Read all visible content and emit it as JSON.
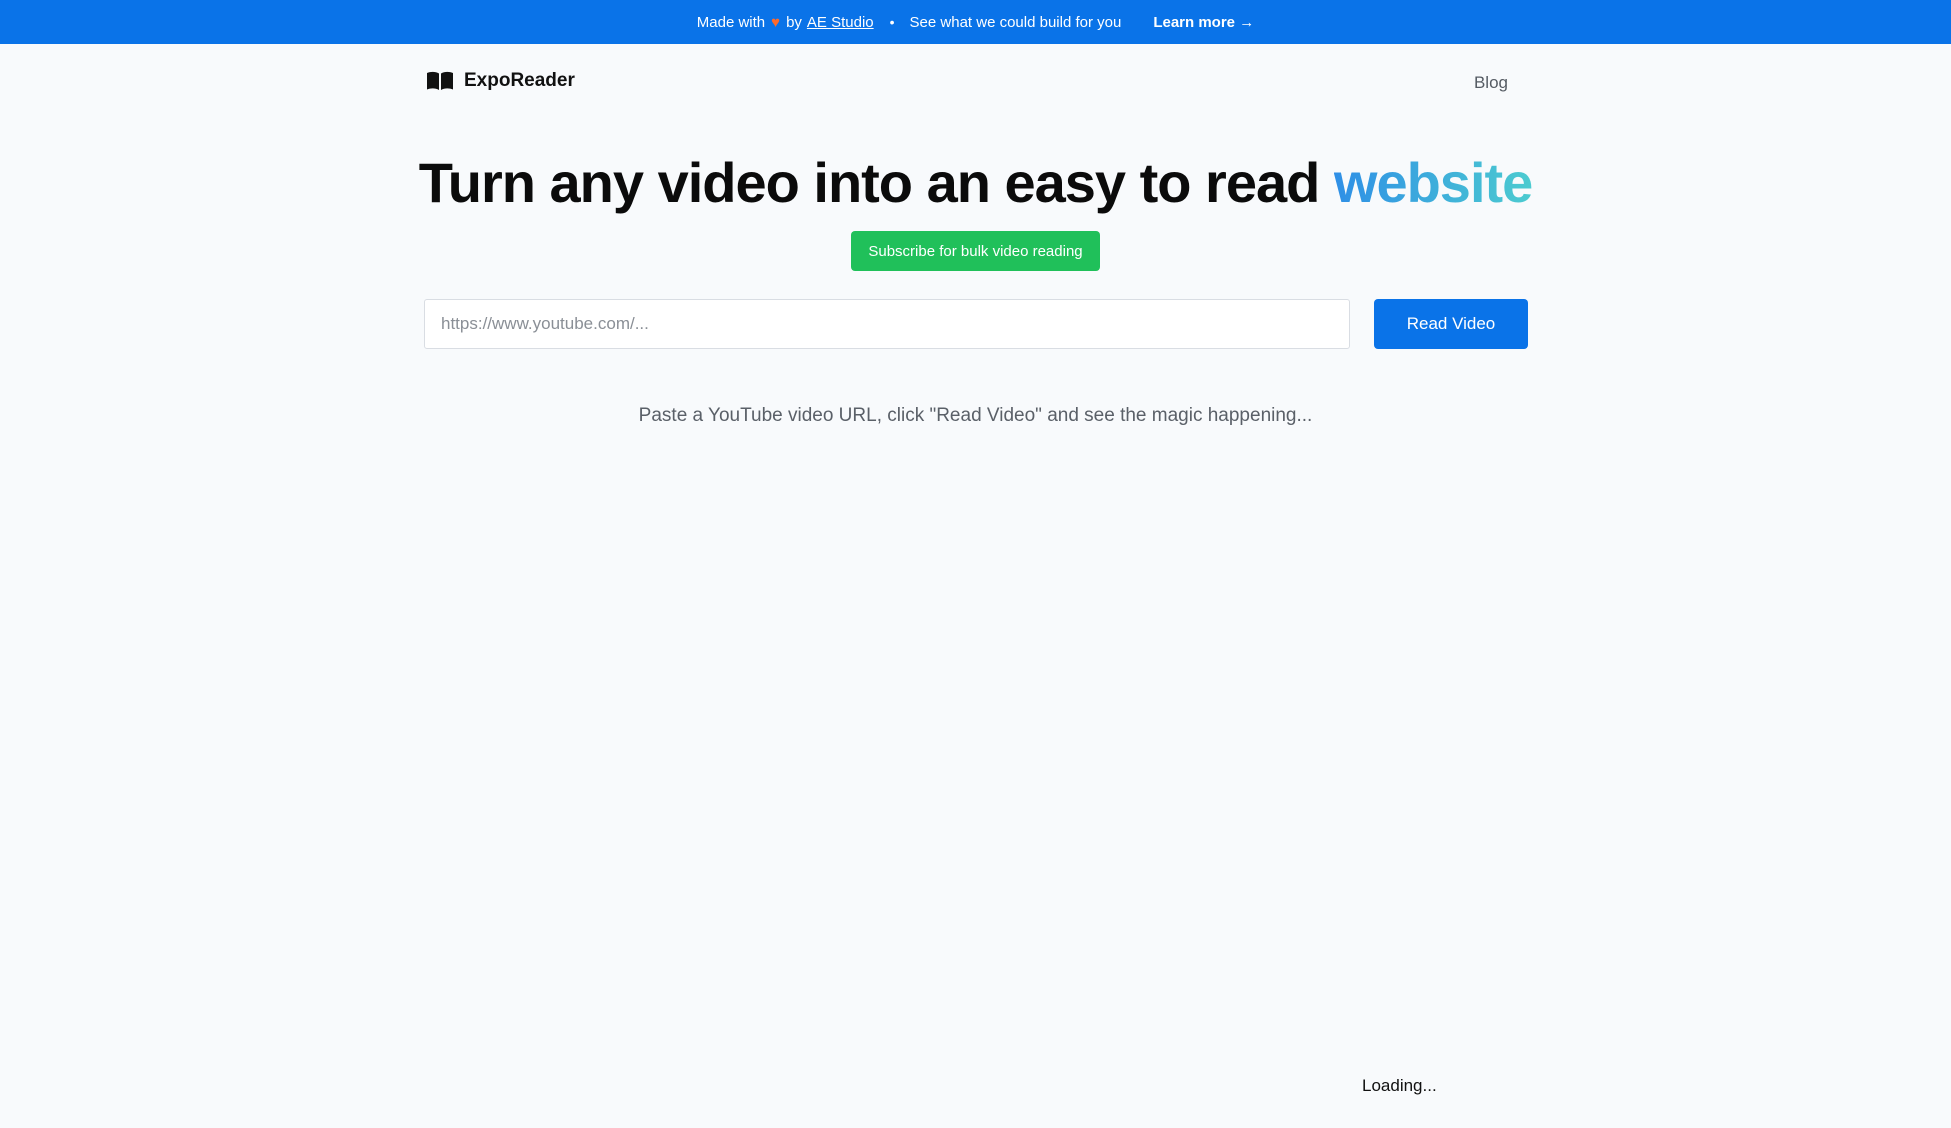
{
  "banner": {
    "made_with": "Made with",
    "heart": "♥",
    "by": "by",
    "studio_link": "AE Studio",
    "bullet": "•",
    "tagline": "See what we could build for you",
    "learn_more": "Learn more →"
  },
  "nav": {
    "brand": "ExpoReader",
    "blog": "Blog"
  },
  "hero": {
    "headline_main": "Turn any video into an easy to read ",
    "headline_accent": "website",
    "subscribe_label": "Subscribe for bulk video reading"
  },
  "search": {
    "placeholder": "https://www.youtube.com/...",
    "value": "",
    "button_label": "Read Video"
  },
  "helper": "Paste a YouTube video URL, click \"Read Video\" and see the magic happening...",
  "status": "Loading...",
  "colors": {
    "banner_bg": "#0a73e8",
    "primary_button": "#0a73e8",
    "subscribe_button": "#20c05a",
    "accent_gradient_start": "#2f8fe6",
    "accent_gradient_end": "#4ccbd0",
    "heart": "#ff6a2b",
    "page_bg": "#f8fafc"
  },
  "icons": {
    "brand_icon": "open-book-icon",
    "heart_icon": "heart-icon"
  }
}
